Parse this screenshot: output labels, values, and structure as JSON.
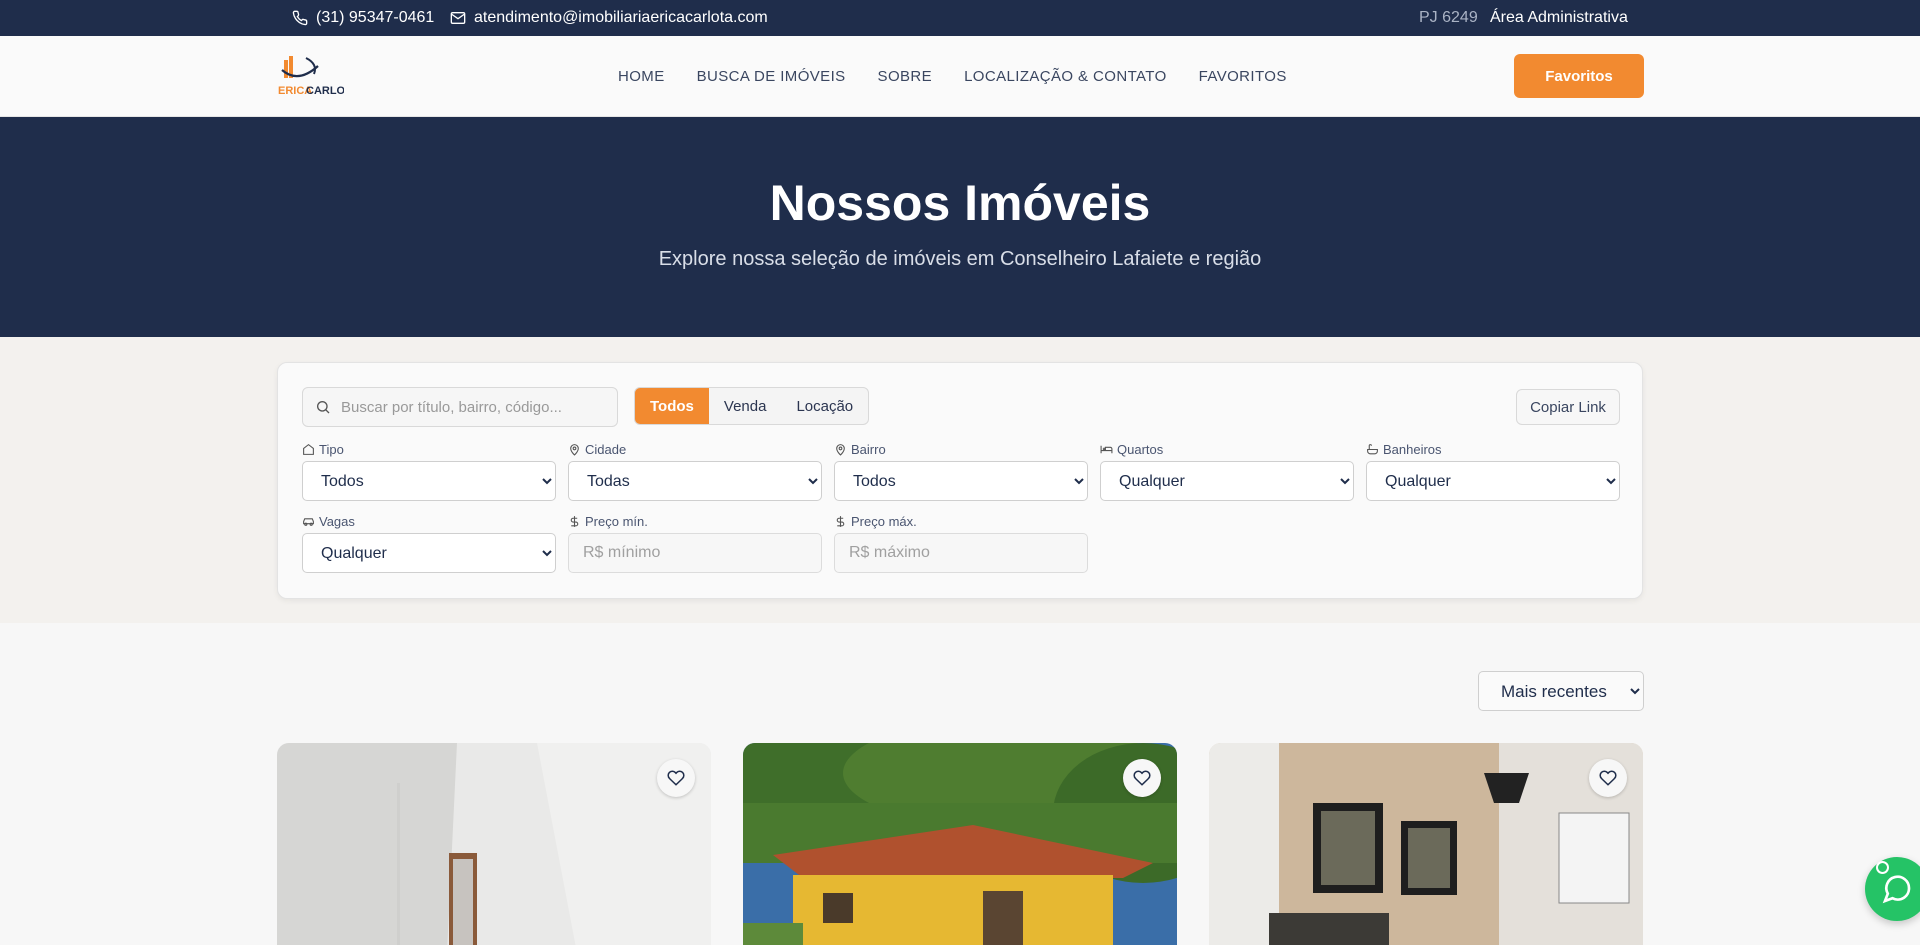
{
  "topbar": {
    "phone": "(31) 95347-0461",
    "email": "atendimento@imobiliariaericacarlota.com",
    "pj": "PJ 6249",
    "admin": "Área Administrativa"
  },
  "header": {
    "logo_text_1": "ERICA",
    "logo_text_2": "CARLOTA",
    "nav": [
      "HOME",
      "BUSCA DE IMÓVEIS",
      "SOBRE",
      "LOCALIZAÇÃO & CONTATO",
      "FAVORITOS"
    ],
    "fav_button": "Favoritos"
  },
  "hero": {
    "title": "Nossos Imóveis",
    "subtitle": "Explore nossa seleção de imóveis em Conselheiro Lafaiete e região"
  },
  "filters": {
    "search_placeholder": "Buscar por título, bairro, código...",
    "segments": [
      "Todos",
      "Venda",
      "Locação"
    ],
    "copy_link": "Copiar Link",
    "tipo": {
      "label": "Tipo",
      "value": "Todos"
    },
    "cidade": {
      "label": "Cidade",
      "value": "Todas"
    },
    "bairro": {
      "label": "Bairro",
      "value": "Todos"
    },
    "quartos": {
      "label": "Quartos",
      "value": "Qualquer"
    },
    "banheiros": {
      "label": "Banheiros",
      "value": "Qualquer"
    },
    "vagas": {
      "label": "Vagas",
      "value": "Qualquer"
    },
    "preco_min": {
      "label": "Preço mín.",
      "placeholder": "R$ mínimo"
    },
    "preco_max": {
      "label": "Preço máx.",
      "placeholder": "R$ máximo"
    }
  },
  "sort": {
    "value": "Mais recentes"
  },
  "colors": {
    "navy": "#1f2d4b",
    "orange": "#f28a30",
    "whatsapp": "#25c366"
  }
}
